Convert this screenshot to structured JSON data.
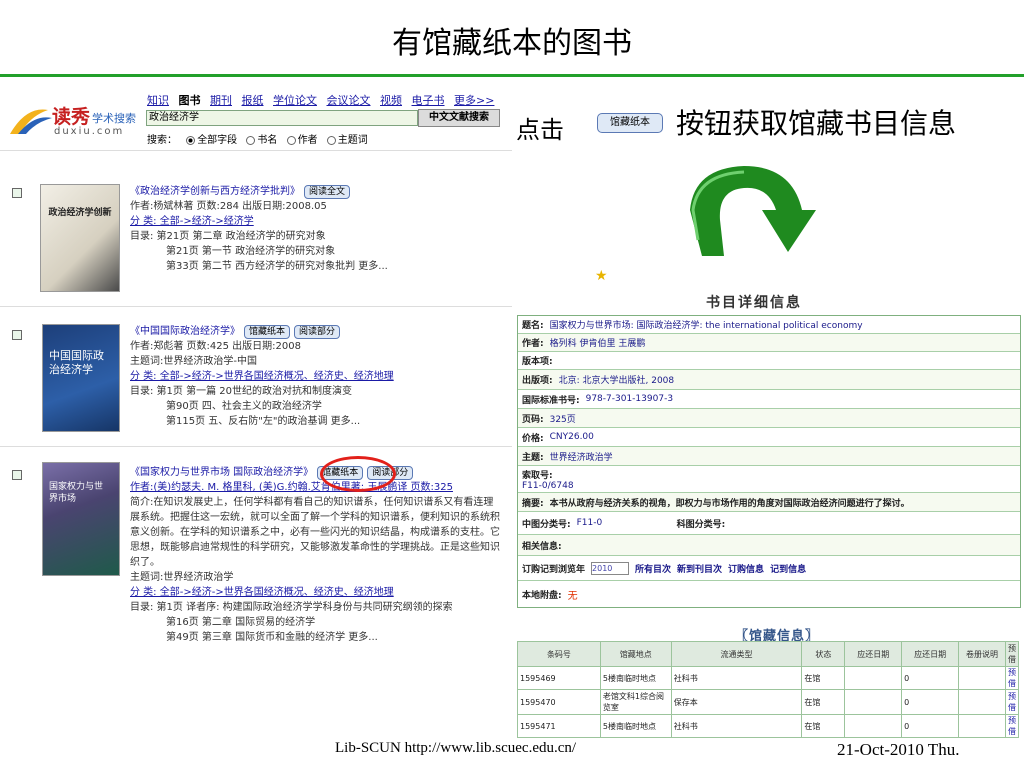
{
  "slide": {
    "title": "有馆藏纸本的图书",
    "click_prefix": "点击",
    "click_button_label": "馆藏纸本",
    "click_desc": "按钮获取馆藏书目信息",
    "footer_left": "Lib-SCUN  http://www.lib.scuec.edu.cn/",
    "footer_right": "21-Oct-2010  Thu.",
    "arrow_color": "#1f8a1f",
    "accent_color": "#22a02a"
  },
  "logo": {
    "main": "读秀",
    "sub": "学术搜索",
    "url": "duxiu.com"
  },
  "nav": {
    "items": [
      "知识",
      "图书",
      "期刊",
      "报纸",
      "学位论文",
      "会议论文",
      "视频",
      "电子书",
      "更多>>"
    ],
    "current": "图书"
  },
  "search": {
    "value": "政治经济学",
    "button": "中文文献搜索",
    "label": "搜索：",
    "options": [
      "全部字段",
      "书名",
      "作者",
      "主题词"
    ],
    "selected": "全部字段"
  },
  "results": [
    {
      "cover_text": "政治经济学创新",
      "title": "《政治经济学创新与西方经济学批判》",
      "buttons": [
        "阅读全文"
      ],
      "lines": [
        "作者:杨斌林著  页数:284  出版日期:2008.05",
        "分 类: 全部->经济->经济学",
        "目录:   第21页  第二章  政治经济学的研究对象",
        "第21页  第一节  政治经济学的研究对象",
        "第33页  第二节  西方经济学的研究对象批判  更多..."
      ]
    },
    {
      "cover_text": "中国国际政治经济学",
      "title": "《中国国际政治经济学》",
      "buttons": [
        "馆藏纸本",
        "阅读部分"
      ],
      "lines": [
        "作者:郑彪著  页数:425  出版日期:2008",
        "主题词:世界经济政治学-中国",
        "分 类: 全部->经济->世界各国经济概况、经济史、经济地理",
        "目录:   第1页  第一篇  20世纪的政治对抗和制度演变",
        "第90页  四、社会主义的政治经济学",
        "第115页  五、反右防\"左\"的政治基调  更多..."
      ]
    },
    {
      "cover_text": "国家权力与世界市场",
      "title": "《国家权力与世界市场  国际政治经济学》",
      "buttons": [
        "馆藏纸本",
        "阅读部分"
      ],
      "lines": [
        "作者:(美)约瑟夫. M. 格里科, (美)G.约翰.艾肯伯里著; 王展鹏译  页数:325",
        "简介:在知识发展史上，任何学科都有看自己的知识谱系，任何知识谱系又有看连理",
        "展系统。把握住这一宏统，就可以全面了解一个学科的知识谱系，便利知识的系统积",
        "意义创新。在学科的知识谱系之中，必有一些闪光的知识结晶，构成谱系的支柱。它",
        "思想，既能够启迪常规性的科学研究，又能够激发革命性的学理挑战。正是这些知识",
        "织了。",
        "主题词:世界经济政治学",
        "分 类: 全部->经济->世界各国经济概况、经济史、经济地理",
        "目录:   第1页  译者序: 构建国际政治经济学学科身份与共同研究纲领的探索",
        "第16页  第二章  国际贸易的经济学",
        "第49页  第三章  国际货币和金融的经济学  更多..."
      ]
    }
  ],
  "detail": {
    "heading": "书目详细信息",
    "rows": [
      {
        "label": "题名:",
        "value": "国家权力与世界市场: 国际政治经济学: the international political economy"
      },
      {
        "label": "作者:",
        "value": "格列科  伊肯伯里  王展鹏"
      },
      {
        "label": "版本项:",
        "value": ""
      },
      {
        "label": "出版项:",
        "value": "北京: 北京大学出版社, 2008"
      },
      {
        "label": "国际标准书号:",
        "value": "978-7-301-13907-3"
      },
      {
        "label": "页码:",
        "value": "325页"
      },
      {
        "label": "价格:",
        "value": "CNY26.00"
      },
      {
        "label": "主题:",
        "value": "世界经济政治学"
      },
      {
        "label": "索取号:",
        "value": "F11-0/6748"
      },
      {
        "label": "摘要:",
        "value": "本书从政府与经济关系的视角，即权力与市场作用的角度对国际政治经济问题进行了探讨。"
      },
      {
        "label": "中图分类号:",
        "value": "F11-0",
        "label2": "科图分类号:",
        "value2": ""
      },
      {
        "label": "相关信息:",
        "value": ""
      },
      {
        "label": "订购记到浏览年",
        "year": "2010",
        "links": [
          "所有目次",
          "新到刊目次",
          "订购信息",
          "记到信息"
        ]
      },
      {
        "label": "本地附盘:",
        "value": "无"
      }
    ]
  },
  "holdings": {
    "heading": "〖馆藏信息〗",
    "columns": [
      "条码号",
      "馆藏地点",
      "流通类型",
      "状态",
      "应还日期",
      "应还日期",
      "卷册说明",
      "预借"
    ],
    "rows": [
      [
        "1595469",
        "5楼南临时地点",
        "社科书",
        "在馆",
        "",
        "0",
        "",
        "预借"
      ],
      [
        "1595470",
        "老馆文科1综合阅览室",
        "保存本",
        "在馆",
        "",
        "0",
        "",
        "预借"
      ],
      [
        "1595471",
        "5楼南临时地点",
        "社科书",
        "在馆",
        "",
        "0",
        "",
        "预借"
      ]
    ]
  }
}
